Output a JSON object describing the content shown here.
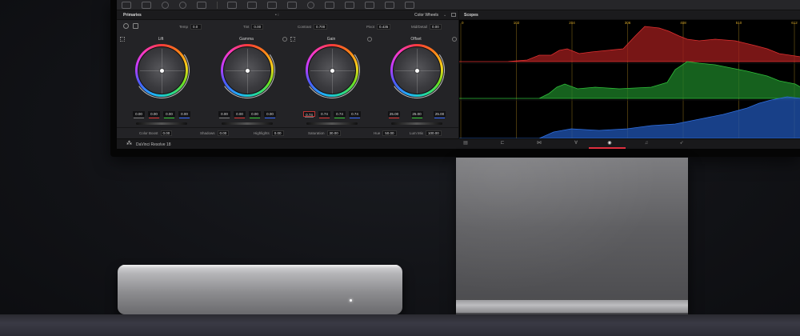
{
  "primaries": {
    "title": "Primaries",
    "dots": "• ⁝",
    "mode": "Color Wheels",
    "mode_arrow": "⌄",
    "adjustments": [
      {
        "label": "Temp",
        "value": "0.0"
      },
      {
        "label": "Tint",
        "value": "0.00"
      },
      {
        "label": "Contrast",
        "value": "0.700"
      },
      {
        "label": "Pivot",
        "value": "0.435"
      },
      {
        "label": "Mid/Detail",
        "value": "0.00"
      }
    ],
    "wheels": [
      {
        "label": "Lift",
        "values": [
          "0.00",
          "0.00",
          "0.00",
          "0.00"
        ]
      },
      {
        "label": "Gamma",
        "values": [
          "0.00",
          "0.00",
          "0.00",
          "0.00"
        ]
      },
      {
        "label": "Gain",
        "values": [
          "0.74",
          "0.74",
          "0.74",
          "0.74"
        ]
      },
      {
        "label": "Offset",
        "values": [
          "25.00",
          "25.00",
          "25.00",
          "25.00"
        ]
      }
    ],
    "bottom": [
      {
        "label": "Color Boost",
        "value": "0.00"
      },
      {
        "label": "Shadows",
        "value": "0.00"
      },
      {
        "label": "Highlights",
        "value": "0.00"
      },
      {
        "label": "Saturation",
        "value": "30.00"
      },
      {
        "label": "Hue",
        "value": "50.00"
      },
      {
        "label": "Lum Mix",
        "value": "100.00"
      }
    ]
  },
  "scopes": {
    "title": "Scopes",
    "tick_labels": [
      "0",
      "102",
      "204",
      "306",
      "408",
      "510",
      "612"
    ],
    "channel_colors": {
      "red": "#e03030",
      "green": "#2fbf3a",
      "blue": "#2f6fe0"
    }
  },
  "status": {
    "logo": "⁂",
    "app_name": "DaVinci Resolve 18"
  },
  "colors": {
    "accent": "#e03040",
    "tick": "#d9a92a"
  }
}
